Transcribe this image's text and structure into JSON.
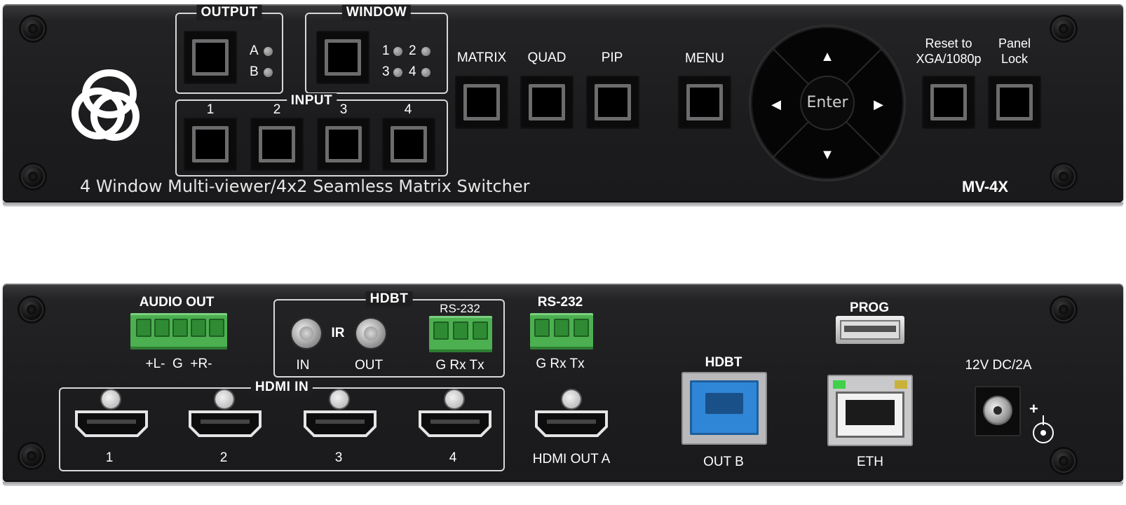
{
  "front": {
    "output": {
      "title": "OUTPUT",
      "leds": [
        "A",
        "B"
      ]
    },
    "window": {
      "title": "WINDOW",
      "leds": [
        "1",
        "2",
        "3",
        "4"
      ]
    },
    "input": {
      "title": "INPUT",
      "numbers": [
        "1",
        "2",
        "3",
        "4"
      ]
    },
    "buttons": {
      "matrix": "MATRIX",
      "quad": "QUAD",
      "pip": "PIP",
      "menu": "MENU"
    },
    "reset": {
      "line1": "Reset to",
      "line2": "XGA/1080p"
    },
    "panel_lock": {
      "line1": "Panel",
      "line2": "Lock"
    },
    "nav": {
      "enter": "Enter",
      "up": "▲",
      "down": "▼",
      "left": "◀",
      "right": "▶"
    },
    "description": "4 Window Multi-viewer/4x2 Seamless Matrix Switcher",
    "model": "MV-4X"
  },
  "rear": {
    "audio_out": {
      "title": "AUDIO OUT",
      "pins": "+L-  G  +R-"
    },
    "hdbt_group": {
      "title": "HDBT",
      "ir": "IR",
      "ir_in": "IN",
      "ir_out": "OUT",
      "rs232_label": "RS-232",
      "rs232_pins": "G Rx Tx"
    },
    "rs232": {
      "title": "RS-232",
      "pins": "G Rx Tx"
    },
    "hdmi_in": {
      "title": "HDMI IN",
      "ports": [
        "1",
        "2",
        "3",
        "4"
      ]
    },
    "hdmi_out_a": "HDMI OUT A",
    "hdbt_out": {
      "title": "HDBT",
      "label": "OUT B"
    },
    "prog": "PROG",
    "eth": "ETH",
    "power": {
      "label": "12V DC/2A",
      "plus": "+"
    }
  },
  "colors": {
    "panel": "#1c1c1e",
    "terminal_green": "#4caf50",
    "hdbt_blue": "#2f86d6",
    "led_green": "#3fd14a",
    "led_yellow": "#c8b23a"
  }
}
